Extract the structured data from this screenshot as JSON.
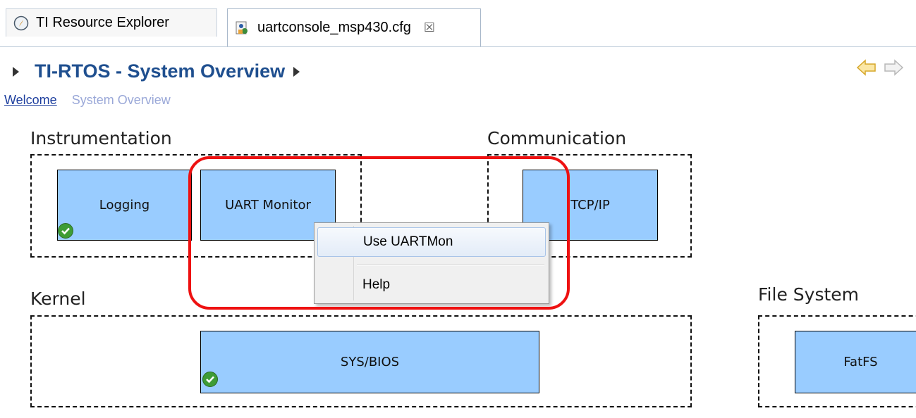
{
  "tabs": [
    {
      "label": "TI Resource Explorer",
      "icon": "compass-icon"
    },
    {
      "label": "uartconsole_msp430.cfg",
      "icon": "config-file-icon",
      "close": "☒"
    }
  ],
  "header": {
    "title": "TI-RTOS - System Overview"
  },
  "breadcrumb": {
    "welcome": "Welcome",
    "system_overview": "System Overview"
  },
  "sections": {
    "instrumentation": "Instrumentation",
    "communication": "Communication",
    "kernel": "Kernel",
    "file_system": "File System"
  },
  "modules": {
    "logging": {
      "label": "Logging",
      "enabled": true
    },
    "uart_monitor": {
      "label": "UART Monitor",
      "enabled": false
    },
    "tcpip": {
      "label": "TCP/IP",
      "enabled": false
    },
    "sysbios": {
      "label": "SYS/BIOS",
      "enabled": true
    },
    "fatfs": {
      "label": "FatFS",
      "enabled": false
    }
  },
  "context_menu": {
    "items": [
      "Use UARTMon",
      "Help"
    ]
  },
  "colors": {
    "module_fill": "#99ccff",
    "title": "#1f4f8f",
    "annotation": "#ee1111",
    "check": "#3e9c35"
  }
}
